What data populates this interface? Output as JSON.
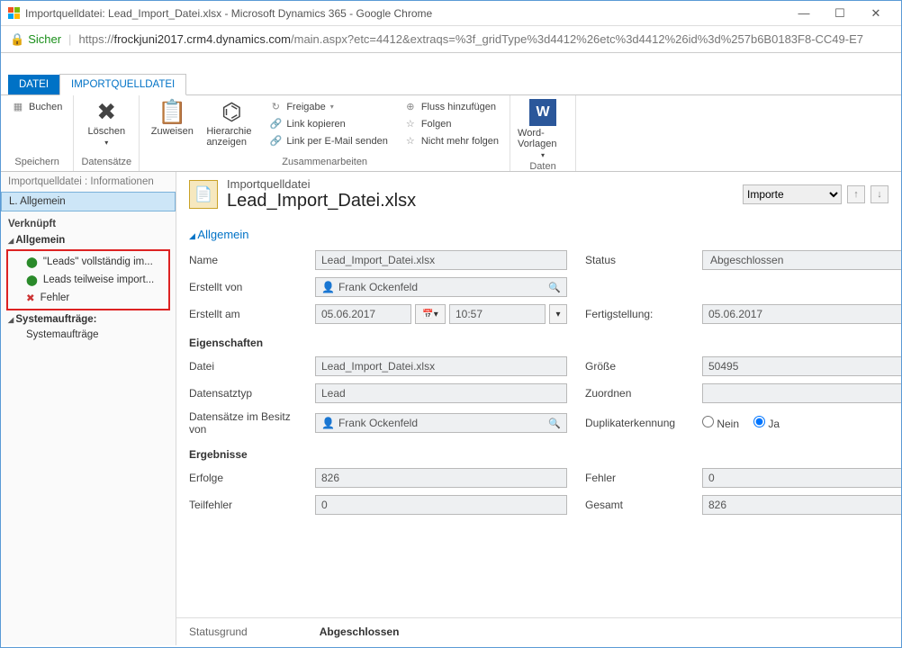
{
  "window": {
    "title": "Importquelldatei: Lead_Import_Datei.xlsx - Microsoft Dynamics 365 - Google Chrome"
  },
  "address": {
    "secure": "Sicher",
    "url_prefix": "https://",
    "url_host": "frockjuni2017.crm4.dynamics.com",
    "url_path": "/main.aspx?etc=4412&extraqs=%3f_gridType%3d4412%26etc%3d4412%26id%3d%257b6B0183F8-CC49-E7"
  },
  "tabs": {
    "datei": "DATEI",
    "importquelldatei": "IMPORTQUELLDATEI"
  },
  "ribbon": {
    "speichern": {
      "buchen": "Buchen",
      "group": "Speichern"
    },
    "datensaetze": {
      "loeschen": "Löschen",
      "group": "Datensätze"
    },
    "zusammen": {
      "zuweisen": "Zuweisen",
      "hierarchie": "Hierarchie anzeigen",
      "freigabe": "Freigabe",
      "link_kopieren": "Link kopieren",
      "link_email": "Link per E-Mail senden",
      "fluss": "Fluss hinzufügen",
      "folgen": "Folgen",
      "nicht_folgen": "Nicht mehr folgen",
      "group": "Zusammenarbeiten"
    },
    "daten": {
      "word": "Word-Vorlagen",
      "group": "Daten"
    }
  },
  "leftnav": {
    "breadcrumb": "Importquelldatei : Informationen",
    "allgemein_item": "L. Allgemein",
    "verknuepft": "Verknüpft",
    "allgemein_section": "Allgemein",
    "leads_voll": "\"Leads\" vollständig im...",
    "leads_teil": "Leads teilweise import...",
    "fehler": "Fehler",
    "systemauftraege_section": "Systemaufträge:",
    "systemauftraege": "Systemaufträge"
  },
  "header": {
    "subtitle": "Importquelldatei",
    "title": "Lead_Import_Datei.xlsx",
    "view": "Importe"
  },
  "form": {
    "section_allgemein": "Allgemein",
    "name": {
      "label": "Name",
      "value": "Lead_Import_Datei.xlsx"
    },
    "status": {
      "label": "Status",
      "value": "Abgeschlossen"
    },
    "erstellt_von": {
      "label": "Erstellt von",
      "value": "Frank Ockenfeld"
    },
    "erstellt_am": {
      "label": "Erstellt am",
      "date": "05.06.2017",
      "time": "10:57"
    },
    "fertigstellung": {
      "label": "Fertigstellung:",
      "value": "05.06.2017"
    },
    "eigenschaften": "Eigenschaften",
    "datei": {
      "label": "Datei",
      "value": "Lead_Import_Datei.xlsx"
    },
    "groesse": {
      "label": "Größe",
      "value": "50495"
    },
    "datensatztyp": {
      "label": "Datensatztyp",
      "value": "Lead"
    },
    "zuordnen": {
      "label": "Zuordnen",
      "value": ""
    },
    "besitz": {
      "label": "Datensätze im Besitz von",
      "value": "Frank Ockenfeld"
    },
    "duplikat": {
      "label": "Duplikaterkennung",
      "nein": "Nein",
      "ja": "Ja"
    },
    "ergebnisse": "Ergebnisse",
    "erfolge": {
      "label": "Erfolge",
      "value": "826"
    },
    "fehler": {
      "label": "Fehler",
      "value": "0"
    },
    "teilfehler": {
      "label": "Teilfehler",
      "value": "0"
    },
    "gesamt": {
      "label": "Gesamt",
      "value": "826"
    }
  },
  "footer": {
    "statusgrund_label": "Statusgrund",
    "statusgrund_value": "Abgeschlossen"
  }
}
